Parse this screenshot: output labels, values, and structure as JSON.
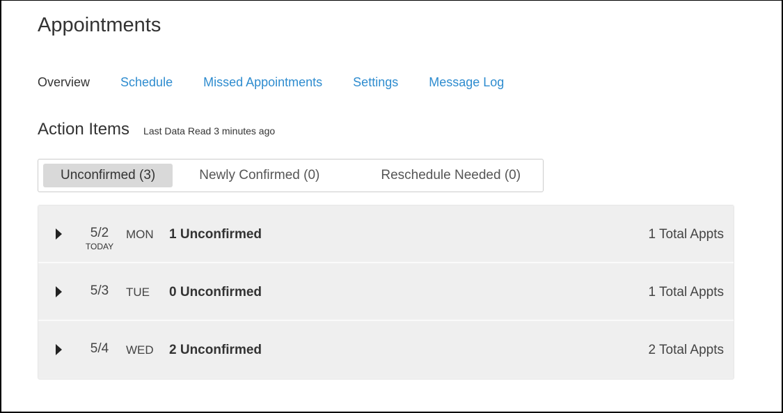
{
  "page": {
    "title": "Appointments"
  },
  "nav": {
    "items": [
      {
        "label": "Overview"
      },
      {
        "label": "Schedule"
      },
      {
        "label": "Missed Appointments"
      },
      {
        "label": "Settings"
      },
      {
        "label": "Message Log"
      }
    ],
    "active_index": 0,
    "link_color": "#2e8ccf"
  },
  "action_items": {
    "title": "Action Items",
    "last_read": "Last Data Read 3 minutes ago",
    "tabs": [
      {
        "label": "Unconfirmed (3)"
      },
      {
        "label": "Newly Confirmed (0)"
      },
      {
        "label": "Reschedule Needed (0)"
      }
    ],
    "active_tab_index": 0,
    "rows": [
      {
        "date": "5/2",
        "sub": "TODAY",
        "dow": "MON",
        "unconfirmed": "1 Unconfirmed",
        "total": "1 Total Appts",
        "expand_icon": "caret-right-icon"
      },
      {
        "date": "5/3",
        "sub": "",
        "dow": "TUE",
        "unconfirmed": "0 Unconfirmed",
        "total": "1 Total Appts",
        "expand_icon": "caret-right-icon"
      },
      {
        "date": "5/4",
        "sub": "",
        "dow": "WED",
        "unconfirmed": "2 Unconfirmed",
        "total": "2 Total Appts",
        "expand_icon": "caret-right-icon"
      }
    ]
  }
}
